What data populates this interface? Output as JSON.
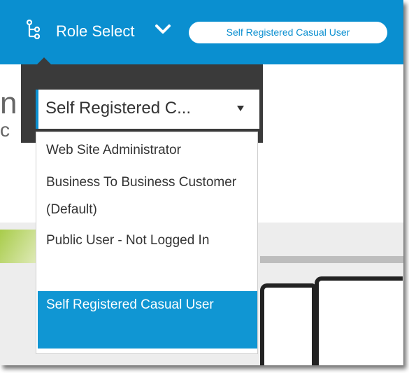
{
  "header": {
    "role_select_label": "Role Select",
    "current_role_badge": "Self Registered Casual User",
    "accent_color": "#0a8fd0",
    "icons": {
      "role": "hierarchy-icon",
      "toggle": "chevron-down-icon"
    }
  },
  "page": {
    "partial_heading": "n",
    "partial_subheading": "c"
  },
  "role_dropdown": {
    "selected_value": "Self Registered C...",
    "options": [
      {
        "label": "Web Site Administrator",
        "selected": false
      },
      {
        "label": "Business To Business Customer (Default)",
        "selected": false
      },
      {
        "label": "Public User - Not Logged In",
        "selected": false
      },
      {
        "label": "Self Registered Casual User",
        "selected": true
      }
    ],
    "highlight_color": "#1096d3"
  }
}
